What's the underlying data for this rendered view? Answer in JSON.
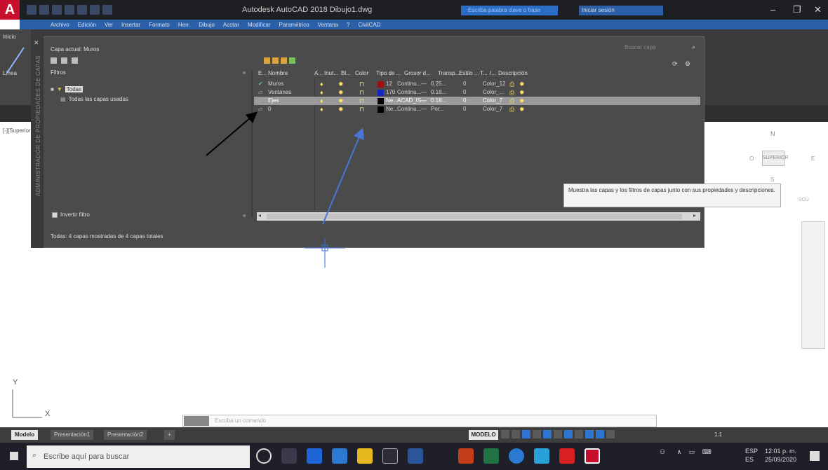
{
  "window": {
    "title": "Autodesk AutoCAD 2018   Dibujo1.dwg",
    "search_placeholder": "Escriba palabra clave o frase",
    "signin_label": "Iniciar sesión",
    "app_letter": "A"
  },
  "menu": [
    "Archivo",
    "Edición",
    "Ver",
    "Insertar",
    "Formato",
    "Herr.",
    "Dibujo",
    "Acotar",
    "Modificar",
    "Paramétrico",
    "Ventana",
    "?",
    "CivilCAD"
  ],
  "ribbon": {
    "left_tab": "Inicio",
    "line_label": "Línea"
  },
  "viewport_label": "[-][Superior]",
  "layer_palette": {
    "current_layer": "Capa actual: Muros",
    "search_placeholder": "Buscar capa",
    "filters_label": "Filtros",
    "filter_tree": [
      {
        "label": "Todas",
        "selected": true
      },
      {
        "label": "Todas las capas usadas",
        "selected": false
      }
    ],
    "invert_filter_label": "Invertir filtro",
    "status": "Todas: 4 capas mostradas de 4 capas totales",
    "side_strip_label": "ADMINISTRADOR DE PROPIEDADES DE CAPAS",
    "columns": [
      "E...",
      "Nombre",
      "A...",
      "Inut...",
      "Bl...",
      "Color",
      "Tipo de ...",
      "Grosor d...",
      "Transp...",
      "Estilo ...",
      "T...",
      "I...",
      "Descripción"
    ],
    "layers": [
      {
        "name": "Muros",
        "color_name": "12",
        "color_hex": "#a01010",
        "linetype": "Continu...",
        "lineweight": "0.25...",
        "transparency": "0",
        "plot_style": "Color_12",
        "selected": false,
        "current": true
      },
      {
        "name": "Ventanas",
        "color_name": "170",
        "color_hex": "#1428c8",
        "linetype": "Continu...",
        "lineweight": "0.18...",
        "transparency": "0",
        "plot_style": "Color_...",
        "selected": false,
        "current": false
      },
      {
        "name": "Ejes",
        "color_name": "Ne...",
        "color_hex": "#000000",
        "linetype": "ACAD_IS...",
        "lineweight": "0.18...",
        "transparency": "0",
        "plot_style": "Color_7",
        "selected": true,
        "current": false
      },
      {
        "name": "0",
        "color_name": "Ne...",
        "color_hex": "#000000",
        "linetype": "Continu...",
        "lineweight": "Por...",
        "transparency": "0",
        "plot_style": "Color_7",
        "selected": false,
        "current": false
      }
    ],
    "tooltip": "Muestra las capas y los filtros de capas junto con sus propiedades y descripciones."
  },
  "viewcube": {
    "north": "N",
    "south": "S",
    "east": "E",
    "west": "O",
    "face": "SUPERIOR",
    "wcs": "SCU"
  },
  "ucs": {
    "x": "X",
    "y": "Y"
  },
  "command_line": {
    "placeholder": "Escriba un comando"
  },
  "layout_tabs": [
    {
      "label": "Modelo",
      "active": true
    },
    {
      "label": "Presentación1",
      "active": false
    },
    {
      "label": "Presentación2",
      "active": false
    }
  ],
  "status_bar": {
    "space": "MODELO",
    "scale": "1:1"
  },
  "taskbar": {
    "search_placeholder": "Escribe aquí para buscar",
    "language": "ESP",
    "language_sub": "ES",
    "time": "12:01 p. m.",
    "date": "25/09/2020"
  },
  "colors": {
    "accent_blue": "#2b5fa8",
    "autocad_red": "#c8102e",
    "palette_bg": "#4b4b4b",
    "arrow_blue": "#4a74d8"
  }
}
